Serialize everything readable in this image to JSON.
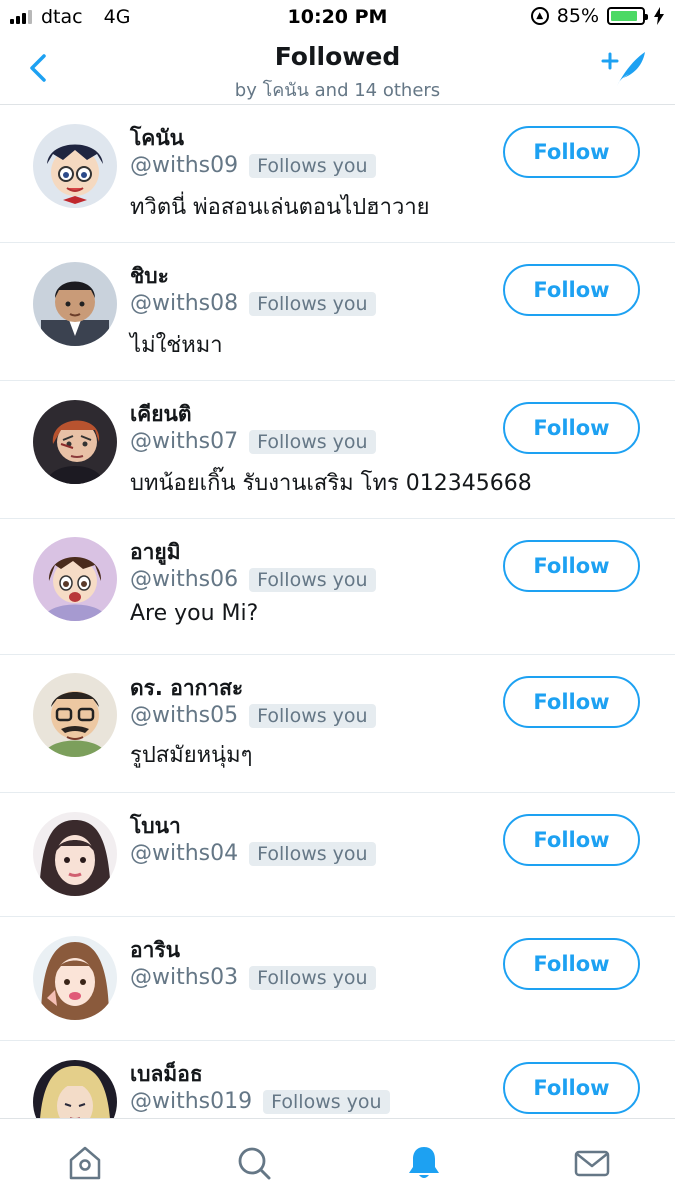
{
  "status_bar": {
    "carrier": "dtac",
    "network": "4G",
    "time": "10:20 PM",
    "battery_level": "85%",
    "battery_fraction": 0.85
  },
  "header": {
    "title": "Followed",
    "subtitle": "by โคนัน and 14 others",
    "back_icon": "chevron-left-icon",
    "compose_icon": "add-feather-icon"
  },
  "users": [
    {
      "name": "โคนัน",
      "handle": "@withs09",
      "follows_you": "Follows you",
      "bio": "ทวิตนี่ พ่อสอนเล่นตอนไปฮาวาย",
      "follow_label": "Follow"
    },
    {
      "name": "ชิบะ",
      "handle": "@withs08",
      "follows_you": "Follows you",
      "bio": "ไม่ใช่หมา",
      "follow_label": "Follow"
    },
    {
      "name": "เคียนติ",
      "handle": "@withs07",
      "follows_you": "Follows you",
      "bio": "บทน้อยเกิ๊น รับงานเสริม โทร 012345668",
      "follow_label": "Follow"
    },
    {
      "name": "อายูมิ",
      "handle": "@withs06",
      "follows_you": "Follows you",
      "bio": "Are you Mi?",
      "follow_label": "Follow"
    },
    {
      "name": "ดร. อากาสะ",
      "handle": "@withs05",
      "follows_you": "Follows you",
      "bio": "รูปสมัยหนุ่มๆ",
      "follow_label": "Follow"
    },
    {
      "name": "โบนา",
      "handle": "@withs04",
      "follows_you": "Follows you",
      "bio": "",
      "follow_label": "Follow"
    },
    {
      "name": "อาริน",
      "handle": "@withs03",
      "follows_you": "Follows you",
      "bio": "",
      "follow_label": "Follow"
    },
    {
      "name": "เบลม็อธ",
      "handle": "@withs019",
      "follows_you": "Follows you",
      "bio": "",
      "follow_label": "Follow"
    }
  ],
  "tab_bar": {
    "tabs": [
      {
        "icon": "home-icon",
        "active": false
      },
      {
        "icon": "search-icon",
        "active": false
      },
      {
        "icon": "bell-icon",
        "active": true
      },
      {
        "icon": "mail-icon",
        "active": false
      }
    ]
  },
  "colors": {
    "accent": "#1da1f2",
    "text": "#14171a",
    "secondary_text": "#657786",
    "divider": "#e6ecf0",
    "battery": "#4cd964"
  }
}
